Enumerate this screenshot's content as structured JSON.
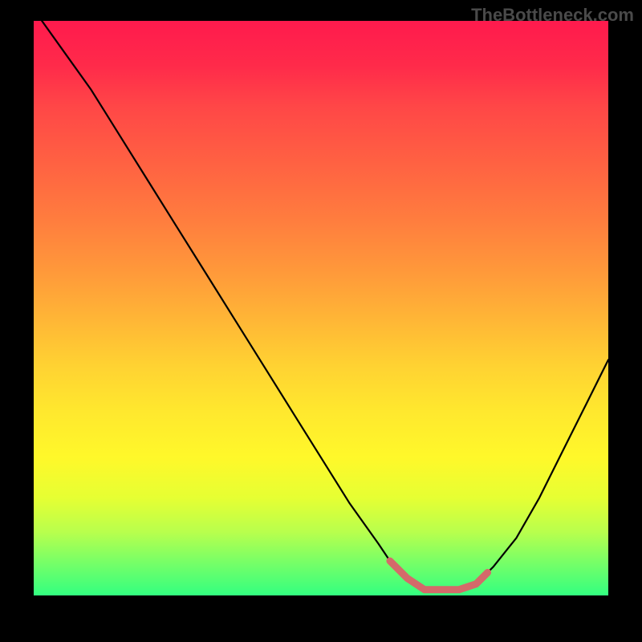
{
  "watermark": "TheBottleneck.com",
  "chart_data": {
    "type": "line",
    "title": "",
    "xlabel": "",
    "ylabel": "",
    "xlim": [
      0,
      100
    ],
    "ylim": [
      0,
      100
    ],
    "grid": false,
    "series": [
      {
        "name": "bottleneck-curve",
        "color": "#000000",
        "x": [
          0,
          5,
          10,
          15,
          20,
          25,
          30,
          35,
          40,
          45,
          50,
          55,
          60,
          62,
          65,
          68,
          71,
          74,
          77,
          80,
          84,
          88,
          92,
          96,
          100
        ],
        "values": [
          102,
          95,
          88,
          80,
          72,
          64,
          56,
          48,
          40,
          32,
          24,
          16,
          9,
          6,
          3,
          1,
          1,
          1,
          2,
          5,
          10,
          17,
          25,
          33,
          41
        ]
      },
      {
        "name": "highlight-band",
        "color": "#d46a6a",
        "x": [
          62,
          65,
          68,
          71,
          74,
          77,
          79
        ],
        "values": [
          6,
          3,
          1,
          1,
          1,
          2,
          4
        ]
      }
    ],
    "gradient": {
      "type": "vertical",
      "stops": [
        {
          "pos": 0.0,
          "color": "#ff1a4d"
        },
        {
          "pos": 0.5,
          "color": "#ffc433"
        },
        {
          "pos": 0.8,
          "color": "#fff82a"
        },
        {
          "pos": 1.0,
          "color": "#33ff80"
        }
      ]
    }
  }
}
